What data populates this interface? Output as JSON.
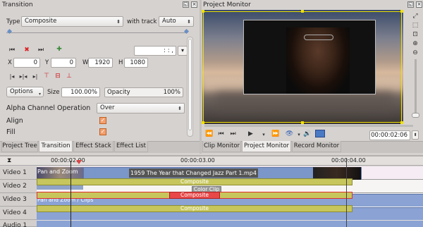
{
  "transition_panel": {
    "title": "Transition",
    "type_label": "Type",
    "type_value": "Composite",
    "with_track_label": "with track",
    "with_track_value": "Auto",
    "timecode_value": ": : ,",
    "x_label": "X",
    "x_value": "0",
    "y_label": "Y",
    "y_value": "0",
    "w_label": "W",
    "w_value": "1920",
    "h_label": "H",
    "h_value": "1080",
    "options_label": "Options",
    "size_label": "Size",
    "size_value": "100.00%",
    "opacity_label": "Opacity",
    "opacity_value": "100%",
    "alpha_label": "Alpha Channel Operation",
    "alpha_value": "Over",
    "align_label": "Align",
    "fill_label": "Fill",
    "accent": "#f2a070"
  },
  "left_tabs": [
    "Project Tree",
    "Transition",
    "Effect Stack",
    "Effect List"
  ],
  "monitor": {
    "title": "Project Monitor",
    "timecode": "00:00:02:06",
    "tabs": [
      "Clip Monitor",
      "Project Monitor",
      "Record Monitor"
    ],
    "selection_color": "#f0e000"
  },
  "timeline": {
    "position": "00:00:02:06",
    "ruler_labels": [
      "00:00:02.00",
      "00:00:03.00",
      "00:00:04.00"
    ],
    "tracks": [
      "Video 1",
      "Video 2",
      "Video 3",
      "Video 4",
      "Audio 1"
    ],
    "clips": {
      "pan_zoom": "Pan and Zoom",
      "jazz": "1959 The Year that Changed Jazz Part 1.mp4",
      "color_clip": "Color Clip",
      "composite": "Composite",
      "v3_left": "Pan and Zoom / Clips"
    }
  }
}
